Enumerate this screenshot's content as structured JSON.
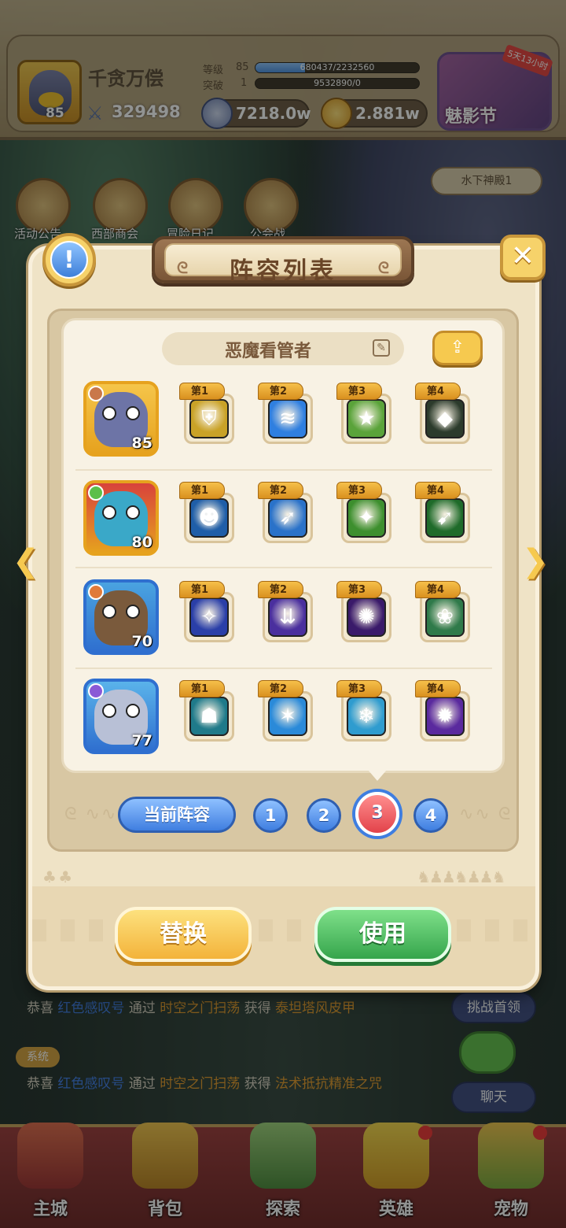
{
  "player": {
    "name": "千贪万偿",
    "level": "85",
    "power": "329498",
    "level_label": "等级",
    "level_value": "85",
    "level_bar_text": "680437/2232560",
    "level_progress": 0.305,
    "break_label": "突破",
    "break_value": "1",
    "break_bar_text": "9532890/0",
    "break_progress": 0
  },
  "currency": {
    "silver": "7218.0w",
    "gold": "2.881w"
  },
  "event": {
    "name": "魅影节",
    "tag": "5天13小时"
  },
  "side_menu": [
    {
      "label": "活动公告"
    },
    {
      "label": "西部商会"
    },
    {
      "label": "冒险日记"
    },
    {
      "label": "公会战"
    }
  ],
  "location": "水下神殿1",
  "modal": {
    "title": "阵容列表",
    "team_name": "恶魔看管者",
    "heroes": [
      {
        "level": "85",
        "colors": {
          "border": "#e6a21e",
          "bg": "#f5c54a",
          "body": "#6d74a6"
        },
        "element_color": "#c9784a",
        "skills": [
          {
            "tag": "第1",
            "icon": "shield-icon",
            "color": "#c9a227",
            "glyph": "⛨"
          },
          {
            "tag": "第2",
            "icon": "water-dash-icon",
            "color": "#2f7fe0",
            "glyph": "≋"
          },
          {
            "tag": "第3",
            "icon": "star-shield-icon",
            "color": "#5aa33a",
            "glyph": "★"
          },
          {
            "tag": "第4",
            "icon": "dark-armor-icon",
            "color": "#2c3b2c",
            "glyph": "◆"
          }
        ]
      },
      {
        "level": "80",
        "colors": {
          "border": "#e6a21e",
          "bg": "#d8423c",
          "body": "#3aa8c8"
        },
        "element_color": "#5cbf4a",
        "skills": [
          {
            "tag": "第1",
            "icon": "tiger-warrior-icon",
            "color": "#1f5ea8",
            "glyph": "☻"
          },
          {
            "tag": "第2",
            "icon": "spear-icon",
            "color": "#2a72c9",
            "glyph": "➶"
          },
          {
            "tag": "第3",
            "icon": "poison-strike-icon",
            "color": "#3d8f2e",
            "glyph": "✦"
          },
          {
            "tag": "第4",
            "icon": "green-spear-icon",
            "color": "#1f6b2a",
            "glyph": "➹"
          }
        ]
      },
      {
        "level": "70",
        "colors": {
          "border": "#2f6fcf",
          "bg": "#4aa3e0",
          "body": "#7a5a3c"
        },
        "element_color": "#e07a3a",
        "skills": [
          {
            "tag": "第1",
            "icon": "ice-shard-icon",
            "color": "#2a3fa8",
            "glyph": "✧"
          },
          {
            "tag": "第2",
            "icon": "arcane-beam-icon",
            "color": "#4a2f9e",
            "glyph": "⇊"
          },
          {
            "tag": "第3",
            "icon": "void-burst-icon",
            "color": "#3a1a6a",
            "glyph": "✺"
          },
          {
            "tag": "第4",
            "icon": "peach-plant-icon",
            "color": "#2f7a4a",
            "glyph": "❀"
          }
        ]
      },
      {
        "level": "77",
        "colors": {
          "border": "#2f6fcf",
          "bg": "#5ab3ea",
          "body": "#b8c0d6"
        },
        "element_color": "#8a5ad6",
        "skills": [
          {
            "tag": "第1",
            "icon": "red-mask-icon",
            "color": "#1f7a8a",
            "glyph": "☗"
          },
          {
            "tag": "第2",
            "icon": "ice-spike-icon",
            "color": "#2a8ad9",
            "glyph": "✶"
          },
          {
            "tag": "第3",
            "icon": "frost-mace-icon",
            "color": "#2f9ccf",
            "glyph": "❄"
          },
          {
            "tag": "第4",
            "icon": "arcane-orb-icon",
            "color": "#5a2a9e",
            "glyph": "✹"
          }
        ]
      }
    ],
    "current_label": "当前阵容",
    "pages": [
      "1",
      "2",
      "3",
      "4"
    ],
    "active_page": "3",
    "replace_label": "替换",
    "use_label": "使用"
  },
  "chat": {
    "line1_prefix": "恭喜",
    "line1_user": "红色感叹号",
    "line1_via": "通过",
    "line1_place": "时空之门扫荡",
    "line1_got": "获得",
    "line1_item": "泰坦塔风皮甲",
    "system_tag": "系统",
    "line2_prefix": "恭喜",
    "line2_user": "红色感叹号",
    "line2_via": "通过",
    "line2_place": "时空之门扫荡",
    "line2_got": "获得",
    "line2_item": "法术抵抗精准之咒"
  },
  "right_buttons": {
    "boss": "挑战首领",
    "chat": "聊天"
  },
  "nav": [
    {
      "label": "主城"
    },
    {
      "label": "背包"
    },
    {
      "label": "探索"
    },
    {
      "label": "英雄"
    },
    {
      "label": "宠物"
    }
  ]
}
